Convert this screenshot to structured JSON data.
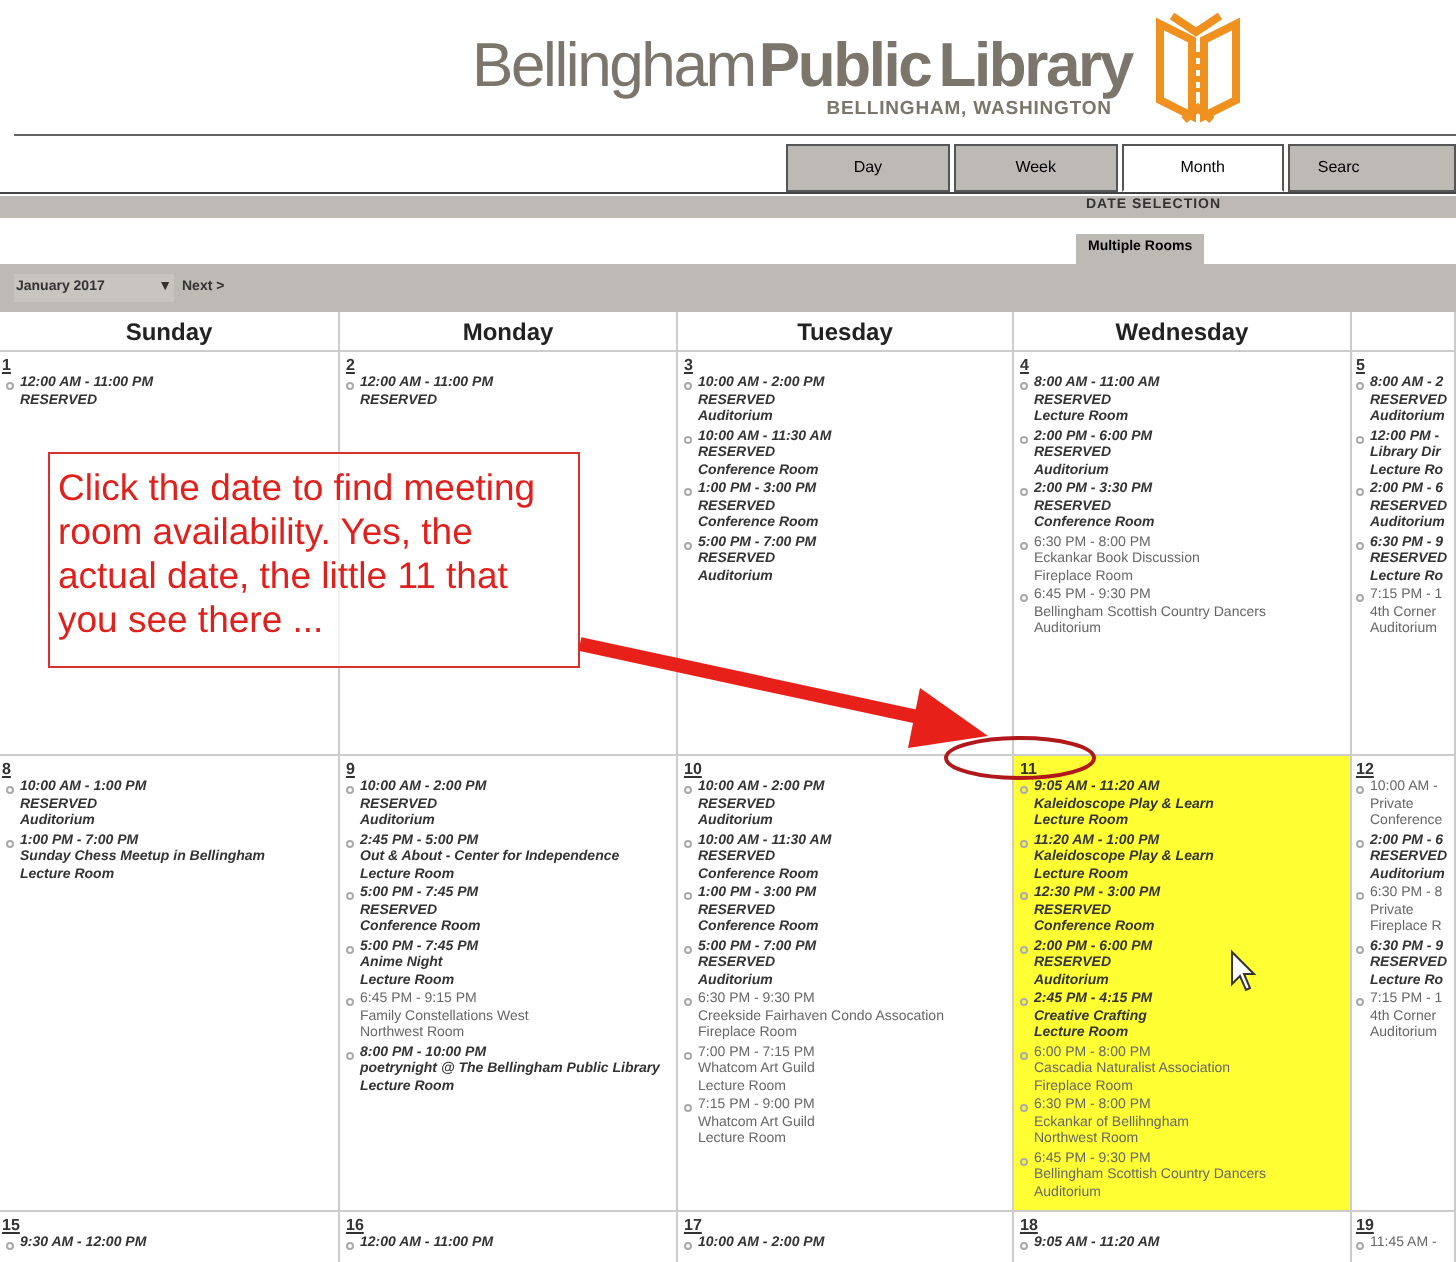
{
  "header": {
    "logo_words": [
      "Bellingham",
      "Public",
      "Library"
    ],
    "subtitle": "BELLINGHAM, WASHINGTON"
  },
  "view_tabs": [
    {
      "label": "Day",
      "selected": false
    },
    {
      "label": "Week",
      "selected": false
    },
    {
      "label": "Month",
      "selected": true
    },
    {
      "label": "Searc",
      "selected": false
    }
  ],
  "date_selection": {
    "title": "DATE SELECTION",
    "tabs": [
      {
        "label": "Multiple Rooms",
        "selected": true
      }
    ]
  },
  "month_select": {
    "value": "January 2017",
    "arrow": "▼"
  },
  "next_link": "Next >",
  "weekdays": [
    "Sunday",
    "Monday",
    "Tuesday",
    "Wednesday"
  ],
  "weeks": [
    [
      {
        "date": "1",
        "highlighted": false,
        "events": [
          {
            "kind": "booked",
            "lines": [
              "12:00 AM - 11:00 PM",
              "RESERVED"
            ]
          }
        ]
      },
      {
        "date": "2",
        "highlighted": false,
        "events": [
          {
            "kind": "booked",
            "lines": [
              "12:00 AM - 11:00 PM",
              "RESERVED"
            ]
          }
        ]
      },
      {
        "date": "3",
        "highlighted": false,
        "events": [
          {
            "kind": "booked",
            "lines": [
              "10:00 AM - 2:00 PM",
              "RESERVED",
              "Auditorium"
            ]
          },
          {
            "kind": "booked",
            "lines": [
              "10:00 AM - 11:30 AM",
              "RESERVED",
              "Conference Room"
            ]
          },
          {
            "kind": "booked",
            "lines": [
              "1:00 PM - 3:00 PM",
              "RESERVED",
              "Conference Room"
            ]
          },
          {
            "kind": "booked",
            "lines": [
              "5:00 PM - 7:00 PM",
              "RESERVED",
              "Auditorium"
            ]
          }
        ]
      },
      {
        "date": "4",
        "highlighted": false,
        "events": [
          {
            "kind": "booked",
            "lines": [
              "8:00 AM - 11:00 AM",
              "RESERVED",
              "Lecture Room"
            ]
          },
          {
            "kind": "booked",
            "lines": [
              "2:00 PM - 6:00 PM",
              "RESERVED",
              "Auditorium"
            ]
          },
          {
            "kind": "booked",
            "lines": [
              "2:00 PM - 3:30 PM",
              "RESERVED",
              "Conference Room"
            ]
          },
          {
            "kind": "listed",
            "lines": [
              "6:30 PM - 8:00 PM",
              "Eckankar Book Discussion",
              "Fireplace Room"
            ]
          },
          {
            "kind": "listed",
            "lines": [
              "6:45 PM - 9:30 PM",
              "Bellingham Scottish Country Dancers",
              "Auditorium"
            ]
          }
        ]
      },
      {
        "date": "5",
        "highlighted": false,
        "events": [
          {
            "kind": "booked",
            "lines": [
              "8:00 AM - 2",
              "RESERVED",
              "Auditorium"
            ]
          },
          {
            "kind": "booked",
            "lines": [
              "12:00 PM -",
              "Library Dir",
              "Lecture Ro"
            ]
          },
          {
            "kind": "booked",
            "lines": [
              "2:00 PM - 6",
              "RESERVED",
              "Auditorium"
            ]
          },
          {
            "kind": "booked",
            "lines": [
              "6:30 PM - 9",
              "RESERVED",
              "Lecture Ro"
            ]
          },
          {
            "kind": "listed",
            "lines": [
              "7:15 PM - 1",
              "4th Corner",
              "Auditorium"
            ]
          }
        ]
      }
    ],
    [
      {
        "date": "8",
        "highlighted": false,
        "events": [
          {
            "kind": "booked",
            "lines": [
              "10:00 AM - 1:00 PM",
              "RESERVED",
              "Auditorium"
            ]
          },
          {
            "kind": "booked",
            "lines": [
              "1:00 PM - 7:00 PM",
              "Sunday Chess Meetup in Bellingham",
              "Lecture Room"
            ]
          }
        ]
      },
      {
        "date": "9",
        "highlighted": false,
        "events": [
          {
            "kind": "booked",
            "lines": [
              "10:00 AM - 2:00 PM",
              "RESERVED",
              "Auditorium"
            ]
          },
          {
            "kind": "booked",
            "lines": [
              "2:45 PM - 5:00 PM",
              "Out & About - Center for Independence",
              "Lecture Room"
            ]
          },
          {
            "kind": "booked",
            "lines": [
              "5:00 PM - 7:45 PM",
              "RESERVED",
              "Conference Room"
            ]
          },
          {
            "kind": "booked",
            "lines": [
              "5:00 PM - 7:45 PM",
              "Anime Night",
              "Lecture Room"
            ]
          },
          {
            "kind": "listed",
            "lines": [
              "6:45 PM - 9:15 PM",
              "Family Constellations West",
              "Northwest Room"
            ]
          },
          {
            "kind": "booked",
            "lines": [
              "8:00 PM - 10:00 PM",
              "poetrynight @ The Bellingham Public Library",
              "Lecture Room"
            ]
          }
        ]
      },
      {
        "date": "10",
        "highlighted": false,
        "events": [
          {
            "kind": "booked",
            "lines": [
              "10:00 AM - 2:00 PM",
              "RESERVED",
              "Auditorium"
            ]
          },
          {
            "kind": "booked",
            "lines": [
              "10:00 AM - 11:30 AM",
              "RESERVED",
              "Conference Room"
            ]
          },
          {
            "kind": "booked",
            "lines": [
              "1:00 PM - 3:00 PM",
              "RESERVED",
              "Conference Room"
            ]
          },
          {
            "kind": "booked",
            "lines": [
              "5:00 PM - 7:00 PM",
              "RESERVED",
              "Auditorium"
            ]
          },
          {
            "kind": "listed",
            "lines": [
              "6:30 PM - 9:30 PM",
              "Creekside Fairhaven Condo Assocation",
              "Fireplace Room"
            ]
          },
          {
            "kind": "listed",
            "lines": [
              "7:00 PM - 7:15 PM",
              "Whatcom Art Guild",
              "Lecture Room"
            ]
          },
          {
            "kind": "listed",
            "lines": [
              "7:15 PM - 9:00 PM",
              "Whatcom Art Guild",
              "Lecture Room"
            ]
          }
        ]
      },
      {
        "date": "11",
        "highlighted": true,
        "events": [
          {
            "kind": "booked",
            "lines": [
              "9:05 AM - 11:20 AM",
              "Kaleidoscope Play & Learn",
              "Lecture Room"
            ]
          },
          {
            "kind": "booked",
            "lines": [
              "11:20 AM - 1:00 PM",
              "Kaleidoscope Play & Learn",
              "Lecture Room"
            ]
          },
          {
            "kind": "booked",
            "lines": [
              "12:30 PM - 3:00 PM",
              "RESERVED",
              "Conference Room"
            ]
          },
          {
            "kind": "booked",
            "lines": [
              "2:00 PM - 6:00 PM",
              "RESERVED",
              "Auditorium"
            ]
          },
          {
            "kind": "booked",
            "lines": [
              "2:45 PM - 4:15 PM",
              "Creative Crafting",
              "Lecture Room"
            ]
          },
          {
            "kind": "listed",
            "lines": [
              "6:00 PM - 8:00 PM",
              "Cascadia Naturalist Association",
              "Fireplace Room"
            ]
          },
          {
            "kind": "listed",
            "lines": [
              "6:30 PM - 8:00 PM",
              "Eckankar of Bellihngham",
              "Northwest Room"
            ]
          },
          {
            "kind": "listed",
            "lines": [
              "6:45 PM - 9:30 PM",
              "Bellingham Scottish Country Dancers",
              "Auditorium"
            ]
          }
        ]
      },
      {
        "date": "12",
        "highlighted": false,
        "events": [
          {
            "kind": "listed",
            "lines": [
              "10:00 AM -",
              "Private",
              "Conference"
            ]
          },
          {
            "kind": "booked",
            "lines": [
              "2:00 PM - 6",
              "RESERVED",
              "Auditorium"
            ]
          },
          {
            "kind": "listed",
            "lines": [
              "6:30 PM - 8",
              "Private",
              "Fireplace R"
            ]
          },
          {
            "kind": "booked",
            "lines": [
              "6:30 PM - 9",
              "RESERVED",
              "Lecture Ro"
            ]
          },
          {
            "kind": "listed",
            "lines": [
              "7:15 PM - 1",
              "4th Corner",
              "Auditorium"
            ]
          }
        ]
      }
    ],
    [
      {
        "date": "15",
        "highlighted": false,
        "events": [
          {
            "kind": "booked",
            "lines": [
              "9:30 AM - 12:00 PM"
            ]
          }
        ]
      },
      {
        "date": "16",
        "highlighted": false,
        "events": [
          {
            "kind": "booked",
            "lines": [
              "12:00 AM - 11:00 PM"
            ]
          }
        ]
      },
      {
        "date": "17",
        "highlighted": false,
        "events": [
          {
            "kind": "booked",
            "lines": [
              "10:00 AM - 2:00 PM"
            ]
          }
        ]
      },
      {
        "date": "18",
        "highlighted": false,
        "events": [
          {
            "kind": "booked",
            "lines": [
              "9:05 AM - 11:20 AM"
            ]
          }
        ]
      },
      {
        "date": "19",
        "highlighted": false,
        "events": [
          {
            "kind": "listed",
            "lines": [
              "11:45 AM -"
            ]
          }
        ]
      }
    ]
  ],
  "annotation": {
    "text": "Click the date to find meeting room availability. Yes, the actual date, the little 11 that you see there ..."
  }
}
